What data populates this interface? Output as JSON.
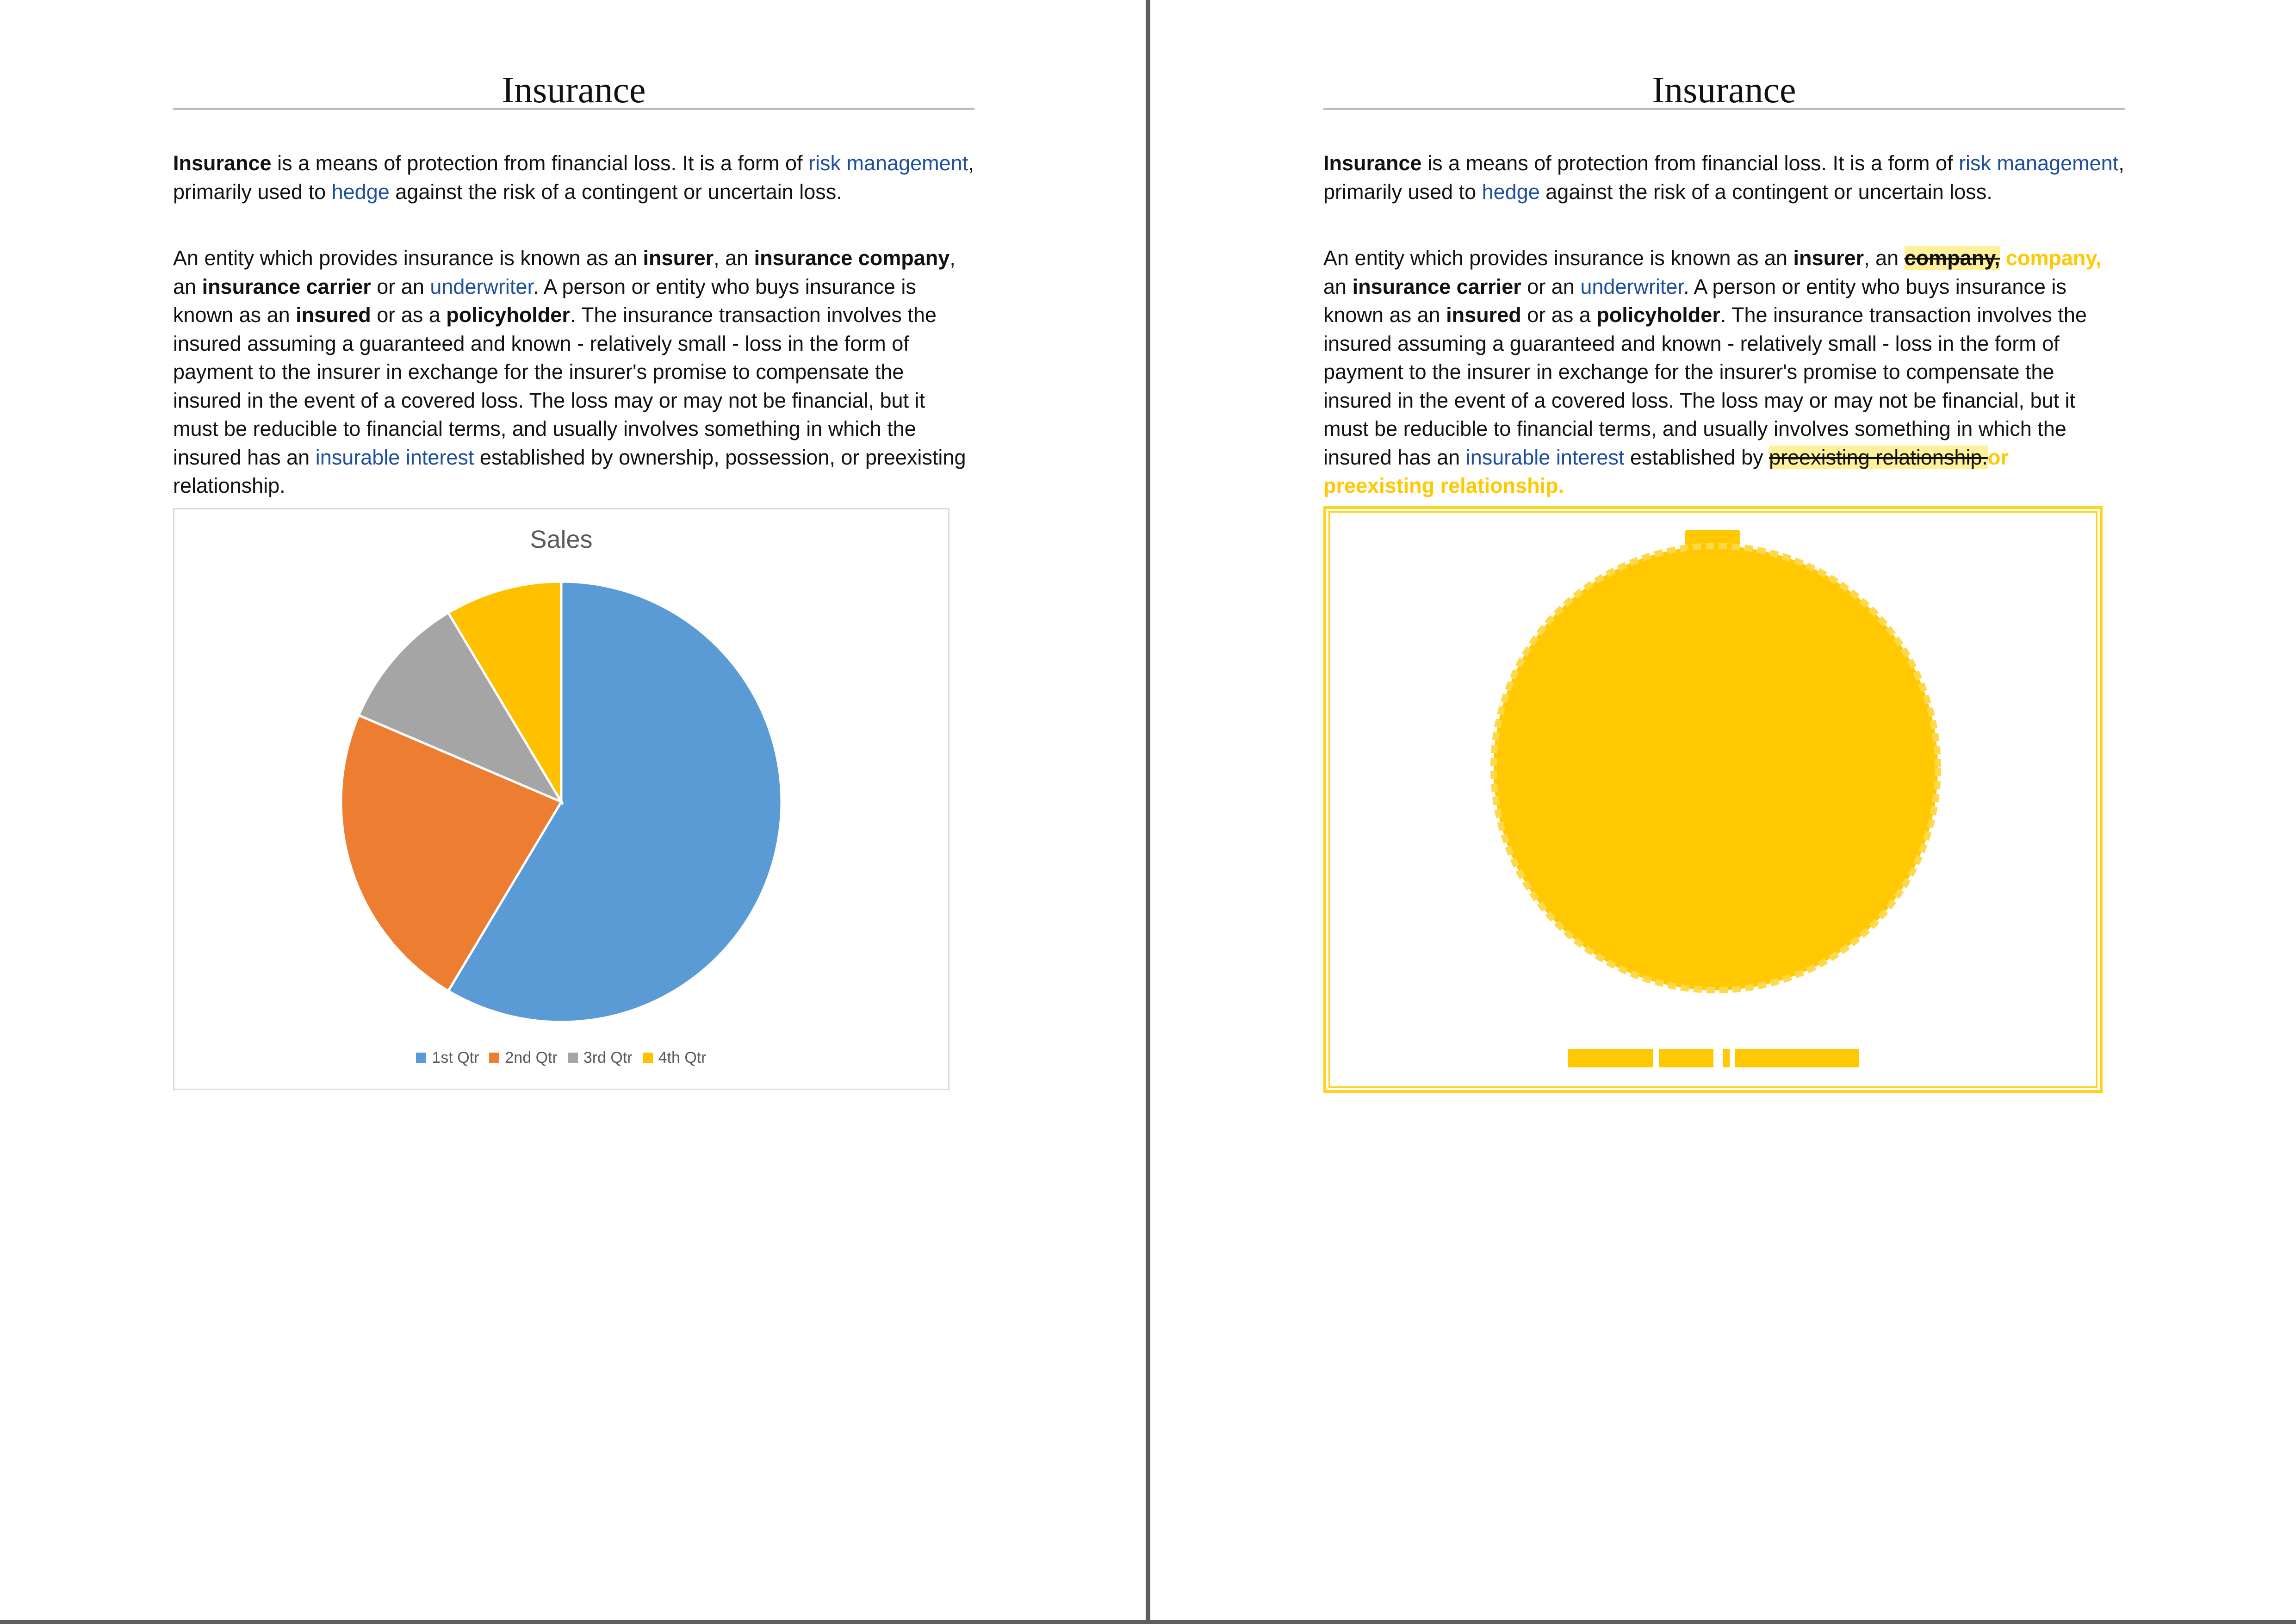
{
  "documents": {
    "left": {
      "title": "Insurance",
      "p1": {
        "b1": "Insurance",
        "t1": " is a means of protection from financial loss. It is a form of ",
        "link1": "risk management",
        "t2": ", primarily used to ",
        "link2": "hedge",
        "t3": " against the risk of a contingent or uncertain loss."
      },
      "p2": {
        "t1": "An entity which provides insurance is known as an ",
        "b1": "insurer",
        "t2": ", an ",
        "b2": "insurance company",
        "t3": ", an ",
        "b3": "insurance carrier",
        "t4": " or an ",
        "link1": "underwriter",
        "t5": ". A person or entity who buys insurance is known as an ",
        "b4": "insured",
        "t6": " or as a ",
        "b5": "policyholder",
        "t7": ". The insurance transaction involves the insured assuming a guaranteed and known - relatively small - loss in the form of payment to the insurer in exchange for the insurer's promise to compensate the insured in the event of a covered loss. The loss may or may not be financial, but it must be reducible to financial terms, and usually involves something in which the insured has an ",
        "link2": "insurable interest",
        "t8": " established by ownership, possession, or preexisting relationship."
      }
    },
    "right": {
      "title": "Insurance",
      "p1": {
        "b1": "Insurance",
        "t1": " is a means of protection from financial loss. It is a form of ",
        "link1": "risk management",
        "t2": ", primarily used to ",
        "link2": "hedge",
        "t3": " against the risk of a contingent or uncertain loss."
      },
      "p2": {
        "t1": "An entity which provides insurance is known as an ",
        "b1": "insurer",
        "t2": ", an ",
        "del1": "company,",
        "ins1": " company,",
        "t3": " an ",
        "b3": "insurance carrier",
        "t4": " or an ",
        "link1": "underwriter",
        "t5": ". A person or entity who buys insurance is known as an ",
        "b4": "insured",
        "t6": " or as a ",
        "b5": "policyholder",
        "t7": ". The insurance transaction involves the insured assuming a guaranteed and known - relatively small - loss in the form of payment to the insurer in exchange for the insurer's promise to compensate the insured in the event of a covered loss. The loss may or may not be financial, but it must be reducible to financial terms, and usually involves something in which the insured has an ",
        "link2": "insurable interest",
        "t8": " established by ",
        "del2": "preexisting relationship.",
        "ins2": "or preexisting relationship."
      }
    }
  },
  "colors": {
    "link": "#1f4e9e",
    "change_highlight": "#ffc800",
    "divider": "#5e5e5e"
  },
  "chart_data": {
    "type": "pie",
    "title": "Sales",
    "categories": [
      "1st Qtr",
      "2nd Qtr",
      "3rd Qtr",
      "4th Qtr"
    ],
    "values": [
      8.2,
      3.2,
      1.4,
      1.2
    ],
    "colors": [
      "#5b9bd5",
      "#ed7d31",
      "#a5a5a5",
      "#ffc000"
    ],
    "legend_position": "bottom"
  }
}
